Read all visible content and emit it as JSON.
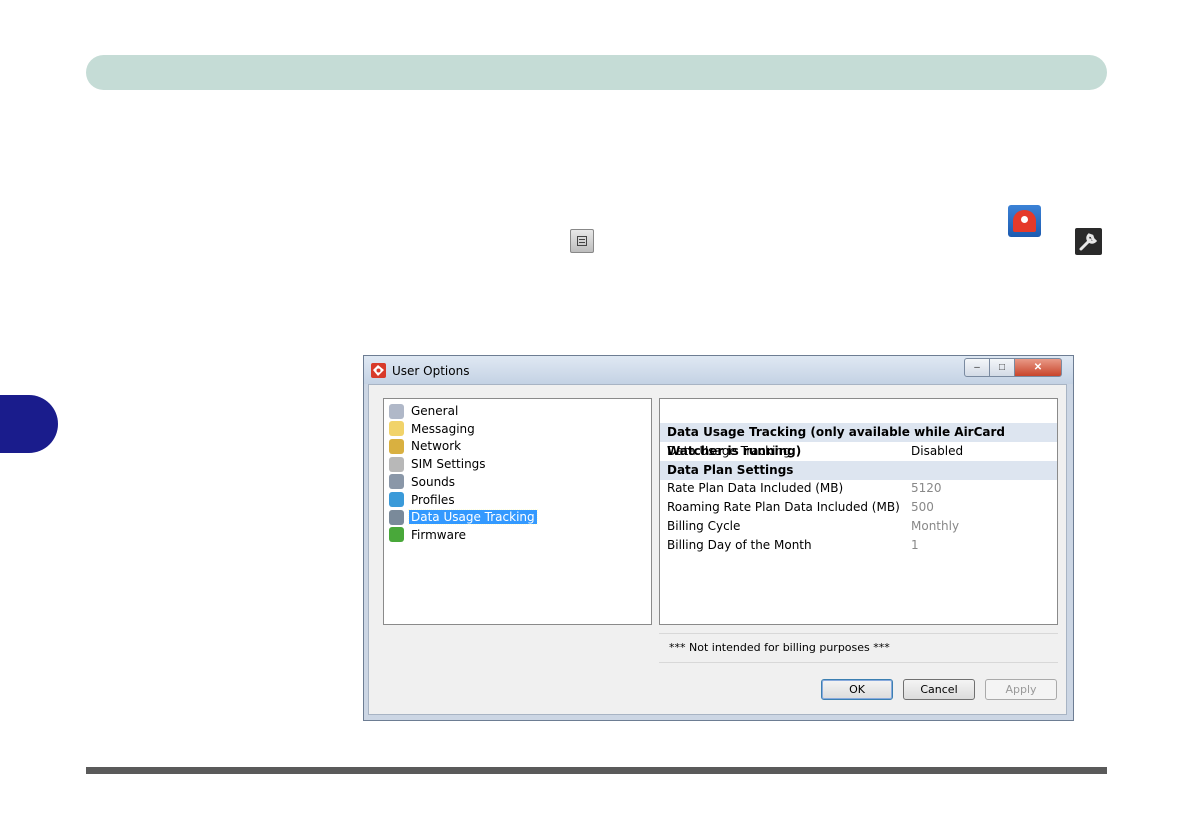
{
  "window": {
    "title": "User Options",
    "controls": {
      "minimize": "–",
      "maximize": "□",
      "close": "✕"
    }
  },
  "tree": {
    "items": [
      {
        "label": "General",
        "icon": "general-icon",
        "color": "#b0b8c8"
      },
      {
        "label": "Messaging",
        "icon": "envelope-icon",
        "color": "#f1d36a"
      },
      {
        "label": "Network",
        "icon": "antenna-icon",
        "color": "#d9b040"
      },
      {
        "label": "SIM Settings",
        "icon": "sim-card-icon",
        "color": "#b8b8b8"
      },
      {
        "label": "Sounds",
        "icon": "speaker-icon",
        "color": "#8a97a8"
      },
      {
        "label": "Profiles",
        "icon": "globe-icon",
        "color": "#3a9ad9"
      },
      {
        "label": "Data Usage Tracking",
        "icon": "data-usage-icon",
        "color": "#7a8a9a",
        "selected": true
      },
      {
        "label": "Firmware",
        "icon": "firmware-icon",
        "color": "#49a83a"
      }
    ]
  },
  "props": {
    "section1_header": "Data Usage Tracking (only available while AirCard Watcher is running)",
    "tracking_label": "Data Usage Tracking",
    "tracking_value": "Disabled",
    "section2_header": "Data Plan Settings",
    "rows": [
      {
        "label": "Rate Plan Data Included (MB)",
        "value": "5120"
      },
      {
        "label": "Roaming Rate Plan Data Included (MB)",
        "value": "500"
      },
      {
        "label": "Billing Cycle",
        "value": "Monthly"
      },
      {
        "label": "Billing Day of the Month",
        "value": "1"
      }
    ]
  },
  "note": "*** Not intended for billing purposes ***",
  "buttons": {
    "ok": "OK",
    "cancel": "Cancel",
    "apply": "Apply"
  }
}
